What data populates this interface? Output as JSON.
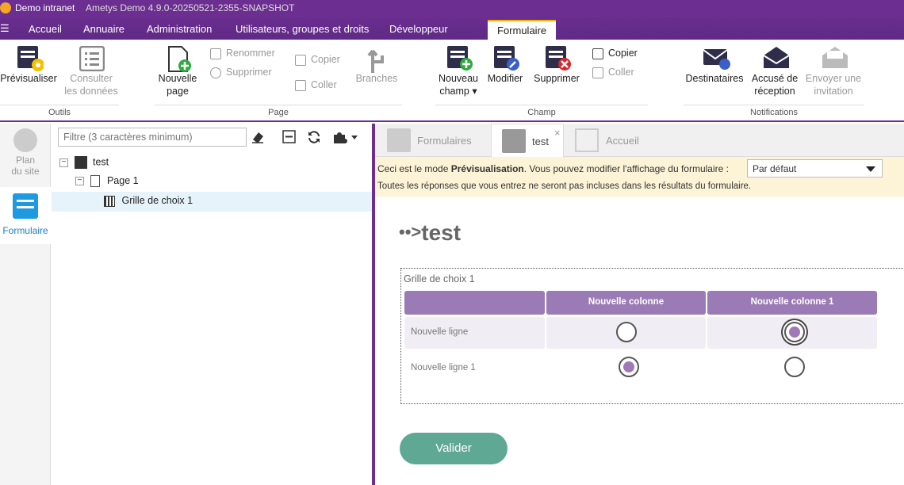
{
  "titlebar": {
    "app": "Demo intranet",
    "version": "Ametys Demo 4.9.0-20250521-2355-SNAPSHOT"
  },
  "menu": {
    "items": [
      "Accueil",
      "Annuaire",
      "Administration",
      "Utilisateurs, groupes et droits",
      "Développeur",
      "Formulaire"
    ]
  },
  "ribbon": {
    "outils": {
      "label": "Outils",
      "preview": "Prévisualiser",
      "consult1": "Consulter",
      "consult2": "les données"
    },
    "page": {
      "label": "Page",
      "new1": "Nouvelle",
      "new2": "page",
      "rename": "Renommer",
      "delete": "Supprimer",
      "copy": "Copier",
      "paste": "Coller",
      "branches": "Branches"
    },
    "champ": {
      "label": "Champ",
      "new1": "Nouveau",
      "new2": "champ ▾",
      "modify": "Modifier",
      "delete": "Supprimer",
      "copy": "Copier",
      "paste": "Coller"
    },
    "notif": {
      "label": "Notifications",
      "recipients": "Destinataires",
      "ack1": "Accusé de",
      "ack2": "réception",
      "invite1": "Envoyer une",
      "invite2": "invitation"
    }
  },
  "leftbar": {
    "plan1": "Plan",
    "plan2": "du site",
    "form": "Formulaire"
  },
  "tree": {
    "filter_placeholder": "Filtre (3 caractères minimum)",
    "root": "test",
    "page": "Page 1",
    "field": "Grille de choix 1"
  },
  "tabs": {
    "forms": "Formulaires",
    "test": "test",
    "home": "Accueil",
    "close": "×"
  },
  "notice": {
    "pre": "Ceci est le mode ",
    "bold": "Prévisualisation",
    "post": ". Vous pouvez modifier l'affichage du formulaire :",
    "line2": "Toutes les réponses que vous entrez ne seront pas incluses dans les résultats du formulaire.",
    "select": "Par défaut"
  },
  "form": {
    "title": "test",
    "arrows": "••>",
    "grid_title": "Grille de choix 1",
    "columns": [
      "Nouvelle colonne",
      "Nouvelle colonne 1"
    ],
    "rows": [
      "Nouvelle ligne",
      "Nouvelle ligne 1"
    ],
    "submit": "Valider"
  },
  "colors": {
    "purple": "#6c2f91",
    "accent": "#9b7bb5",
    "button": "#5fa894",
    "notice": "#fdf3d6"
  }
}
